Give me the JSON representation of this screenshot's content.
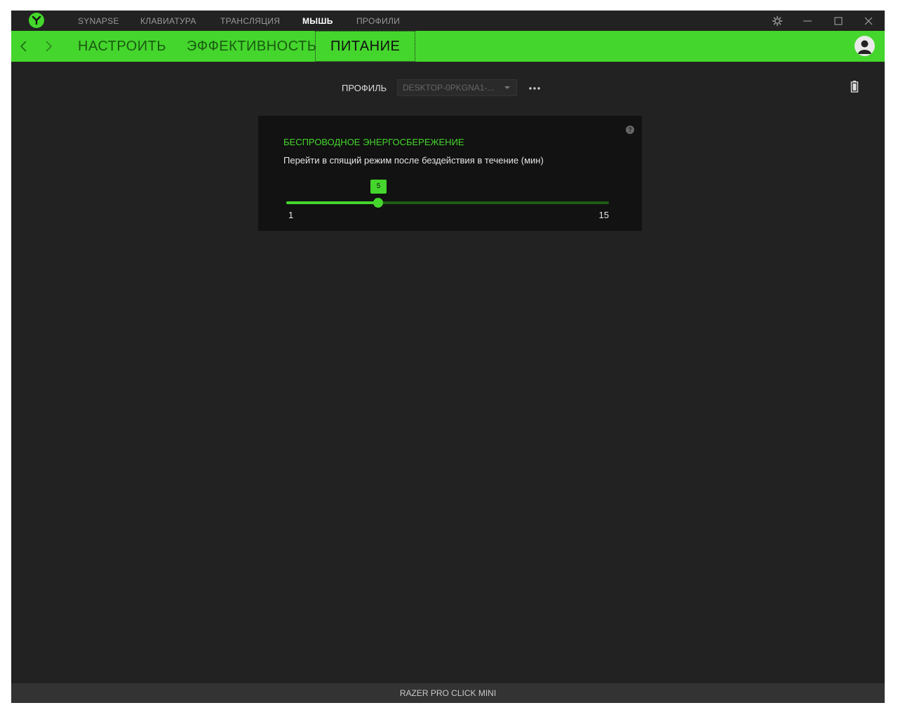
{
  "top_nav": {
    "items": [
      "SYNAPSE",
      "КЛАВИАТУРА",
      "ТРАНСЛЯЦИЯ",
      "МЫШЬ",
      "ПРОФИЛИ"
    ],
    "active": "МЫШЬ"
  },
  "sub_nav": {
    "tabs": [
      "НАСТРОИТЬ",
      "ЭФФЕКТИВНОСТЬ",
      "ПИТАНИЕ"
    ],
    "active": "ПИТАНИЕ"
  },
  "profile": {
    "label": "ПРОФИЛЬ",
    "value": "DESKTOP-0PKGNA1-..."
  },
  "power_card": {
    "title": "БЕСПРОВОДНОЕ ЭНЕРГОСБЕРЕЖЕНИЕ",
    "description": "Перейти в спящий режим после бездействия в течение (мин)",
    "slider": {
      "min": 1,
      "max": 15,
      "value": 5,
      "min_label": "1",
      "max_label": "15",
      "value_label": "5"
    },
    "help_glyph": "?"
  },
  "status_bar": {
    "device": "RAZER PRO CLICK MINI"
  },
  "colors": {
    "accent": "#44d62c",
    "background": "#222222",
    "card": "#121212",
    "track_inactive": "#1f5c16"
  },
  "icons": {
    "logo": "razer-logo-icon",
    "settings": "gear-icon",
    "minimize": "minimize-icon",
    "maximize": "maximize-icon",
    "close": "close-icon",
    "back": "chevron-left-icon",
    "forward": "chevron-right-icon",
    "user": "user-avatar-icon",
    "more": "ellipsis-icon",
    "battery": "battery-icon",
    "help": "help-icon",
    "dropdown": "caret-down-icon"
  }
}
